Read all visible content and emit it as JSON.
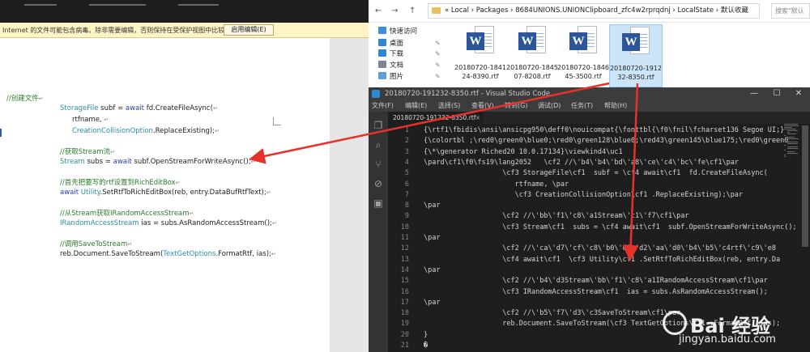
{
  "word": {
    "protected_bar": {
      "message": "Internet 的文件可能包含病毒。除非需要编辑，否则保持在受保护视图中比较安全。",
      "message_prefix": "i",
      "enable_button": "启用编辑(E)"
    },
    "doc_lines": [
      {
        "parts": [
          {
            "t": "//创建文件",
            "c": "cm"
          },
          {
            "t": "↵",
            "c": "mark"
          }
        ]
      },
      {
        "parts": [
          {
            "t": "StorageFile",
            "c": "ty"
          },
          {
            "t": " subf = ",
            "c": "tx"
          },
          {
            "t": "await",
            "c": "kw"
          },
          {
            "t": " fd.CreateFileAsync(",
            "c": "tx"
          },
          {
            "t": "↵",
            "c": "mark"
          }
        ]
      },
      {
        "parts": [
          {
            "t": "rtfname, ",
            "c": "tx"
          },
          {
            "t": "↵",
            "c": "mark"
          }
        ]
      },
      {
        "parts": [
          {
            "t": "CreationCollisionOption",
            "c": "ty"
          },
          {
            "t": ".ReplaceExisting);",
            "c": "tx"
          },
          {
            "t": "↵",
            "c": "mark"
          }
        ]
      },
      {
        "parts": [
          {
            "t": "//获取Stream流",
            "c": "cm"
          },
          {
            "t": "↵",
            "c": "mark"
          }
        ]
      },
      {
        "parts": [
          {
            "t": "Stream",
            "c": "ty"
          },
          {
            "t": " subs = ",
            "c": "tx"
          },
          {
            "t": "await",
            "c": "kw"
          },
          {
            "t": " subf.OpenStreamForWriteAsync();",
            "c": "tx"
          },
          {
            "t": "↵",
            "c": "mark"
          }
        ]
      },
      {
        "parts": [
          {
            "t": "//首先把要写的rtf设置到RichEditBox",
            "c": "cm"
          },
          {
            "t": "↵",
            "c": "mark"
          }
        ]
      },
      {
        "parts": [
          {
            "t": "await",
            "c": "kw"
          },
          {
            "t": " ",
            "c": "tx"
          },
          {
            "t": "Utility",
            "c": "ty"
          },
          {
            "t": ".SetRtfToRichEditBox(reb, entry.DataBufRtfText);",
            "c": "tx"
          },
          {
            "t": "↵",
            "c": "mark"
          }
        ]
      },
      {
        "parts": [
          {
            "t": "//从Stream获取IRandomAccessStream",
            "c": "cm"
          },
          {
            "t": "↵",
            "c": "mark"
          }
        ]
      },
      {
        "parts": [
          {
            "t": "IRandomAccessStream",
            "c": "ty"
          },
          {
            "t": " ias = subs.AsRandomAccessStream();",
            "c": "tx"
          },
          {
            "t": "↵",
            "c": "mark"
          }
        ]
      },
      {
        "parts": [
          {
            "t": "//调用SaveToStream",
            "c": "cm"
          },
          {
            "t": "↵",
            "c": "mark"
          }
        ]
      },
      {
        "parts": [
          {
            "t": "reb.Document.SaveToStream(",
            "c": "tx"
          },
          {
            "t": "TextGetOptions",
            "c": "ty"
          },
          {
            "t": ".FormatRtf, ias);",
            "c": "tx"
          },
          {
            "t": "↵",
            "c": "mark"
          }
        ]
      }
    ]
  },
  "explorer": {
    "nav_back": "←",
    "nav_forward": "→",
    "nav_up": "↑",
    "path": "«  Local  ›  Packages  ›  8684UNIONS.UNIONClipboard_zfc4w2rprqdnj  ›  LocalState  ›  默认收藏",
    "search_placeholder": "搜索\"默认",
    "sidebar": [
      {
        "label": "快速访问",
        "color": "#3b8ee0",
        "pinned": false
      },
      {
        "label": "桌面",
        "color": "#2f86d6",
        "pinned": true
      },
      {
        "label": "下载",
        "color": "#2f86d6",
        "pinned": true
      },
      {
        "label": "文档",
        "color": "#7b8590",
        "pinned": true
      },
      {
        "label": "图片",
        "color": "#5f9ed6",
        "pinned": true
      }
    ],
    "pin_glyph": "✎",
    "files": [
      {
        "name": "20180720-1841\n24-8390.rtf",
        "selected": false
      },
      {
        "name": "20180720-1845\n07-8208.rtf",
        "selected": false
      },
      {
        "name": "20180720-1846\n45-3500.rtf",
        "selected": false
      },
      {
        "name": "20180720-1912\n32-8350.rtf",
        "selected": true
      }
    ],
    "word_badge": "W"
  },
  "vscode": {
    "title": "20180720-191232-8350.rtf - Visual Studio Code",
    "window_buttons": {
      "min": "—",
      "max": "☐",
      "close": "✕"
    },
    "menu": [
      "文件(F)",
      "编辑(E)",
      "选择(S)",
      "查看(V)",
      "转到(G)",
      "调试(D)",
      "任务(T)",
      "帮助(H)"
    ],
    "tab": {
      "label": "20180720-191232-8350.rtf",
      "close": "×"
    },
    "activity_icons": [
      "❐",
      "⌕",
      "⑂",
      "⊘",
      "▣"
    ],
    "lines": [
      {
        "n": "1",
        "t": "{\\rtf1\\fbidis\\ansi\\ansicpg950\\deff0\\nouicompat{\\fonttbl{\\f0\\fnil\\fcharset136 Segoe UI;}"
      },
      {
        "n": "2",
        "t": "{\\colortbl ;\\red0\\green0\\blue0;\\red0\\green128\\blue0;\\red43\\green145\\blue175;\\red0\\green0"
      },
      {
        "n": "3",
        "t": "{\\*\\generator Riched20 10.0.17134}\\viewkind4\\uc1"
      },
      {
        "n": "4",
        "t": "\\pard\\cf1\\f0\\fs19\\lang2052   \\cf2 //\\'b4\\'b4\\'bd\\'a8\\'ce\\'c4\\'bc\\'fe\\cf1\\par"
      },
      {
        "n": "5",
        "t": "                   \\cf3 StorageFile\\cf1  subf = \\cf4 await\\cf1  fd.CreateFileAsync("
      },
      {
        "n": "6",
        "t": "                      rtfname, \\par"
      },
      {
        "n": "7",
        "t": "                      \\cf3 CreationCollisionOption\\cf1 .ReplaceExisting);\\par"
      },
      {
        "n": "8",
        "t": "\\par"
      },
      {
        "n": "9",
        "t": "                   \\cf2 //\\'bb\\'f1\\'c8\\'a1Stream\\'c1\\'f7\\cf1\\par"
      },
      {
        "n": "10",
        "t": "                   \\cf3 Stream\\cf1  subs = \\cf4 await\\cf1  subf.OpenStreamForWriteAsync();"
      },
      {
        "n": "11",
        "t": "\\par"
      },
      {
        "n": "12",
        "t": "                   \\cf2 //\\'ca\\'d7\\'cf\\'c8\\'b0\\'d1\\'d2\\'aa\\'d0\\'b4\\'b5\\'c4rtf\\'c9\\'e8"
      },
      {
        "n": "13",
        "t": "                   \\cf4 await\\cf1  \\cf3 Utility\\cf1 .SetRtfToRichEditBox(reb, entry.Da"
      },
      {
        "n": "14",
        "t": "\\par"
      },
      {
        "n": "15",
        "t": "                   \\cf2 //\\'b4\\'d3Stream\\'bb\\'f1\\'c8\\'a1IRandomAccessStream\\cf1\\par"
      },
      {
        "n": "16",
        "t": "                   \\cf3 IRandomAccessStream\\cf1  ias = subs.AsRandomAccessStream();"
      },
      {
        "n": "17",
        "t": "\\par"
      },
      {
        "n": "18",
        "t": "                   \\cf2 //\\'b5\\'f7\\'d3\\'c3SaveToStream\\cf1\\par"
      },
      {
        "n": "19",
        "t": "                   reb.Document.SaveToStream(\\cf3 TextGetOptions\\cf1 .FormatRtf, ias);"
      },
      {
        "n": "20",
        "t": "}"
      },
      {
        "n": "21",
        "t": "�"
      }
    ]
  },
  "watermark": {
    "brand": "Bai 经验",
    "url": "jingyan.baidu.com"
  },
  "colors": {
    "arrow": "#e8312a",
    "accent": "#2b579a"
  }
}
